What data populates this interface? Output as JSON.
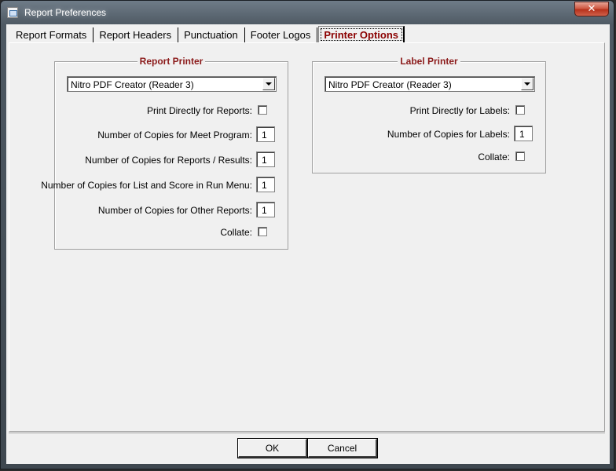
{
  "window": {
    "title": "Report Preferences",
    "close_glyph": "✕"
  },
  "tabs": [
    {
      "label": "Report Formats"
    },
    {
      "label": "Report Headers"
    },
    {
      "label": "Punctuation"
    },
    {
      "label": "Footer Logos"
    },
    {
      "label": "Printer Options",
      "active": true
    }
  ],
  "report_printer": {
    "title": "Report Printer",
    "printer": "Nitro PDF Creator (Reader 3)",
    "print_directly_label": "Print Directly for Reports:",
    "print_directly_checked": false,
    "copies_meet_program_label": "Number of Copies for Meet Program:",
    "copies_meet_program": "1",
    "copies_reports_results_label": "Number of Copies for Reports / Results:",
    "copies_reports_results": "1",
    "copies_list_score_label": "Number of Copies for List and Score in Run Menu:",
    "copies_list_score": "1",
    "copies_other_label": "Number of Copies for Other Reports:",
    "copies_other": "1",
    "collate_label": "Collate:",
    "collate_checked": false
  },
  "label_printer": {
    "title": "Label Printer",
    "printer": "Nitro PDF Creator (Reader 3)",
    "print_directly_label": "Print Directly for Labels:",
    "print_directly_checked": false,
    "copies_labels_label": "Number of Copies for Labels:",
    "copies_labels": "1",
    "collate_label": "Collate:",
    "collate_checked": false
  },
  "buttons": {
    "ok": "OK",
    "cancel": "Cancel"
  }
}
